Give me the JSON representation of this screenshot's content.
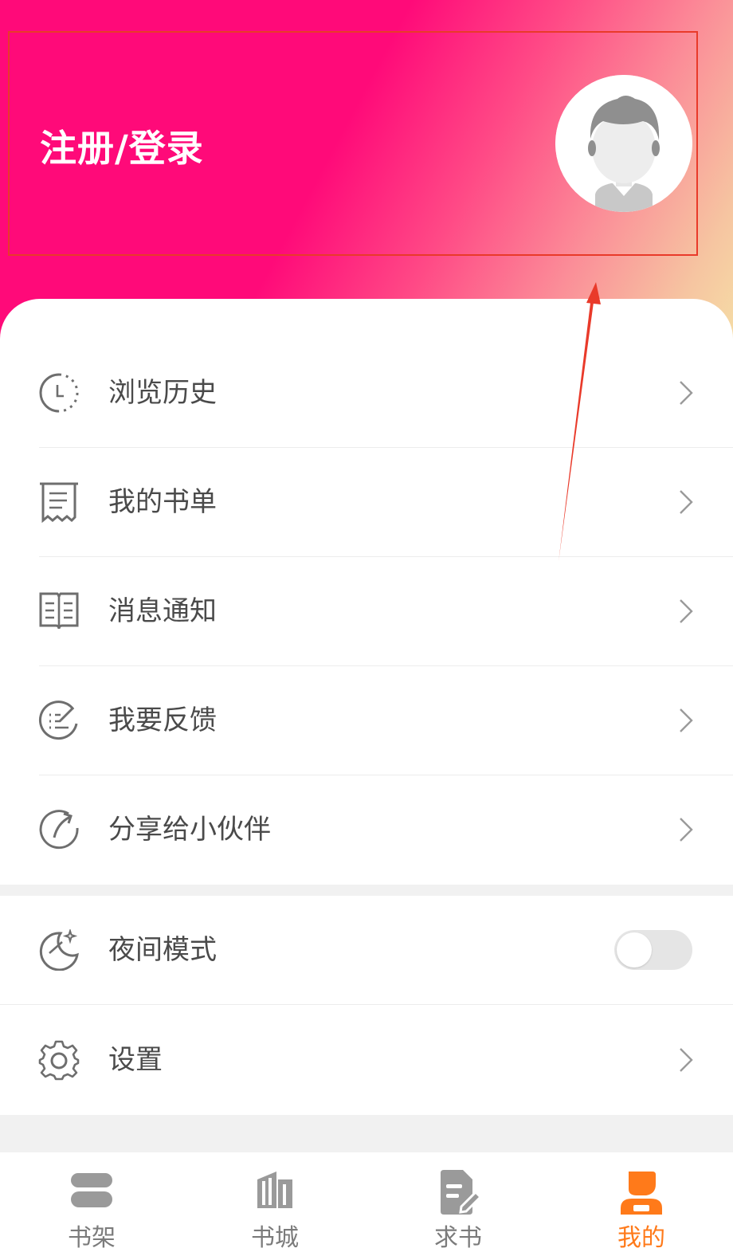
{
  "header": {
    "login_label": "注册/登录"
  },
  "menu": {
    "items": [
      {
        "label": "浏览历史",
        "icon": "history-clock-icon"
      },
      {
        "label": "我的书单",
        "icon": "receipt-list-icon"
      },
      {
        "label": "消息通知",
        "icon": "open-book-icon"
      },
      {
        "label": "我要反馈",
        "icon": "feedback-edit-icon"
      },
      {
        "label": "分享给小伙伴",
        "icon": "share-arc-icon"
      }
    ]
  },
  "settings_section": {
    "night_mode_label": "夜间模式",
    "night_mode_enabled": false,
    "settings_label": "设置"
  },
  "tabbar": {
    "tabs": [
      {
        "label": "书架",
        "icon": "bookshelf-icon",
        "active": false
      },
      {
        "label": "书城",
        "icon": "bookstore-building-icon",
        "active": false
      },
      {
        "label": "求书",
        "icon": "request-book-icon",
        "active": false
      },
      {
        "label": "我的",
        "icon": "profile-user-icon",
        "active": true
      }
    ]
  },
  "colors": {
    "header_gradient_start": "#ff0a79",
    "header_gradient_end": "#f5dca5",
    "active_tab": "#ff7a1a",
    "inactive_tab": "#7b7b7b",
    "annotation": "#e93a2a"
  }
}
